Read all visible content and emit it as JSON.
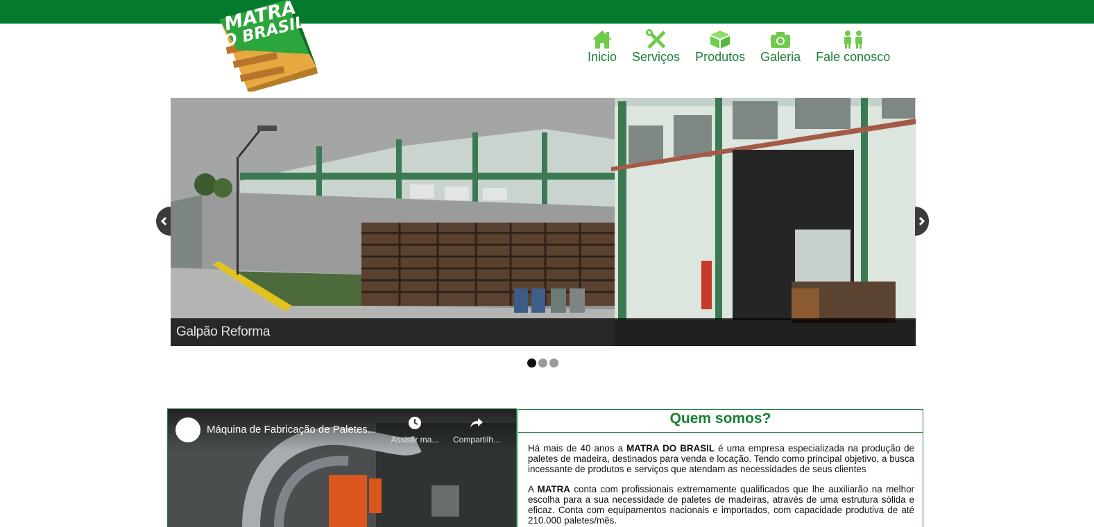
{
  "logo": {
    "line1": "MATRA",
    "line2": "DO BRASIL"
  },
  "nav": {
    "items": [
      {
        "label": "Inicio",
        "icon": "home-icon"
      },
      {
        "label": "Serviços",
        "icon": "tools-icon"
      },
      {
        "label": "Produtos",
        "icon": "box-icon"
      },
      {
        "label": "Galeria",
        "icon": "camera-icon"
      },
      {
        "label": "Fale conosco",
        "icon": "people-icon"
      }
    ]
  },
  "slider": {
    "caption": "Galpão Reforma",
    "slide_count": 3,
    "active_index": 0
  },
  "video": {
    "title": "Máquina de Fabricação de Paletes...",
    "watch_later_label": "Assistir ma...",
    "share_label": "Compartilh..."
  },
  "about": {
    "title": "Quem somos?",
    "p1_before": "Há mais de 40 anos a ",
    "p1_bold": "MATRA DO BRASIL",
    "p1_after": " é uma empresa especializada na produção de paletes de madeira, destinados para venda e locação. Tendo como principal objetivo, a busca incessante de produtos e serviços que atendam as necessidades de seus clientes",
    "p2_before": "A ",
    "p2_bold": "MATRA",
    "p2_after": " conta com profissionais extremamente qualificados que lhe auxiliarão na melhor escolha para a sua necessidade de paletes de madeiras, através de uma estrutura sólida e eficaz. Conta com equipamentos nacionais e importados, com capacidade produtiva de até 210.000 paletes/mês."
  },
  "colors": {
    "brand_green": "#037a2d",
    "nav_green": "#1a7e34",
    "icon_green": "#6fcb4b"
  }
}
